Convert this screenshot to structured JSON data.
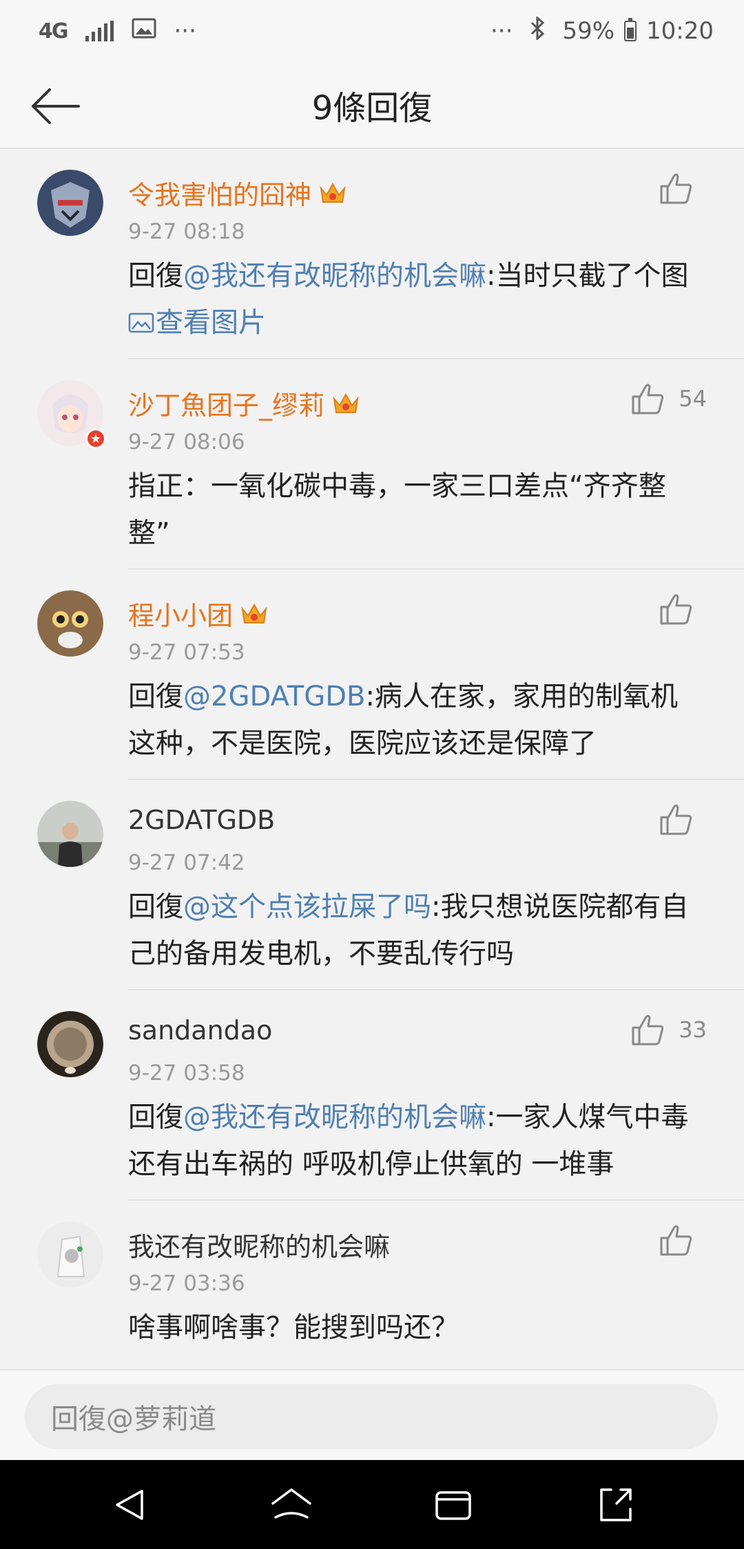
{
  "status_bar": {
    "network": "4G",
    "overflow_left": "···",
    "overflow_right": "···",
    "battery": "59%",
    "time": "10:20"
  },
  "nav": {
    "title": "9條回復"
  },
  "comments": [
    {
      "name": "令我害怕的囧神",
      "vip": true,
      "time": "9-27 08:18",
      "prefix": "回復",
      "mention": "@我还有改昵称的机会嘛",
      "text": ":当时只截了个图 ",
      "extra": "查看图片",
      "likes": ""
    },
    {
      "name": "沙丁魚团子_缪莉",
      "vip": true,
      "time": "9-27 08:06",
      "prefix": "",
      "mention": "",
      "text": "指正：一氧化碳中毒，一家三口差点“齐齐整整”",
      "extra": "",
      "likes": "54"
    },
    {
      "name": "程小小团",
      "vip": true,
      "time": "9-27 07:53",
      "prefix": "回復",
      "mention": "@2GDATGDB",
      "text": ":病人在家，家用的制氧机这种，不是医院，医院应该还是保障了",
      "extra": "",
      "likes": ""
    },
    {
      "name": "2GDATGDB",
      "vip": false,
      "time": "9-27 07:42",
      "prefix": "回復",
      "mention": "@这个点该拉屎了吗",
      "text": ":我只想说医院都有自己的备用发电机，不要乱传行吗",
      "extra": "",
      "likes": ""
    },
    {
      "name": "sandandao",
      "vip": false,
      "time": "9-27 03:58",
      "prefix": "回復",
      "mention": "@我还有改昵称的机会嘛",
      "text": ":一家人煤气中毒 还有出车祸的 呼吸机停止供氧的 一堆事",
      "extra": "",
      "likes": "33"
    },
    {
      "name": "我还有改昵称的机会嘛",
      "vip": false,
      "time": "9-27 03:36",
      "prefix": "",
      "mention": "",
      "text": "啥事啊啥事？能搜到吗还？",
      "extra": "",
      "likes": ""
    }
  ],
  "reply": {
    "placeholder": "回復@萝莉道"
  },
  "colors": {
    "name_vip": "#e8731c",
    "mention": "#4f7fb2",
    "time": "#9a9a9a",
    "background": "#f2f2f2"
  }
}
